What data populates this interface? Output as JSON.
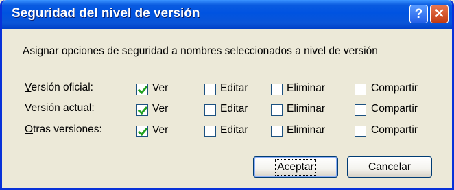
{
  "dialog": {
    "title": "Seguridad del nivel de versión",
    "help_glyph": "?",
    "close_glyph": "✕",
    "description": "Asignar opciones de seguridad a nombres seleccionados a nivel de versión"
  },
  "rows": [
    {
      "label_mnemonic": "V",
      "label_rest": "ersión oficial:",
      "ver": true,
      "editar": false,
      "eliminar": false,
      "compartir": false
    },
    {
      "label_mnemonic": "V",
      "label_rest": "ersión actual:",
      "ver": true,
      "editar": false,
      "eliminar": false,
      "compartir": false
    },
    {
      "label_mnemonic": "O",
      "label_rest": "tras versiones:",
      "ver": true,
      "editar": false,
      "eliminar": false,
      "compartir": false
    }
  ],
  "options": {
    "ver": "Ver",
    "editar": "Editar",
    "eliminar": "Eliminar",
    "compartir": "Compartir"
  },
  "buttons": {
    "accept": "Aceptar",
    "cancel": "Cancelar"
  },
  "colors": {
    "titlebar": "#0053E1",
    "face": "#ECE9D8",
    "check": "#21A121"
  }
}
